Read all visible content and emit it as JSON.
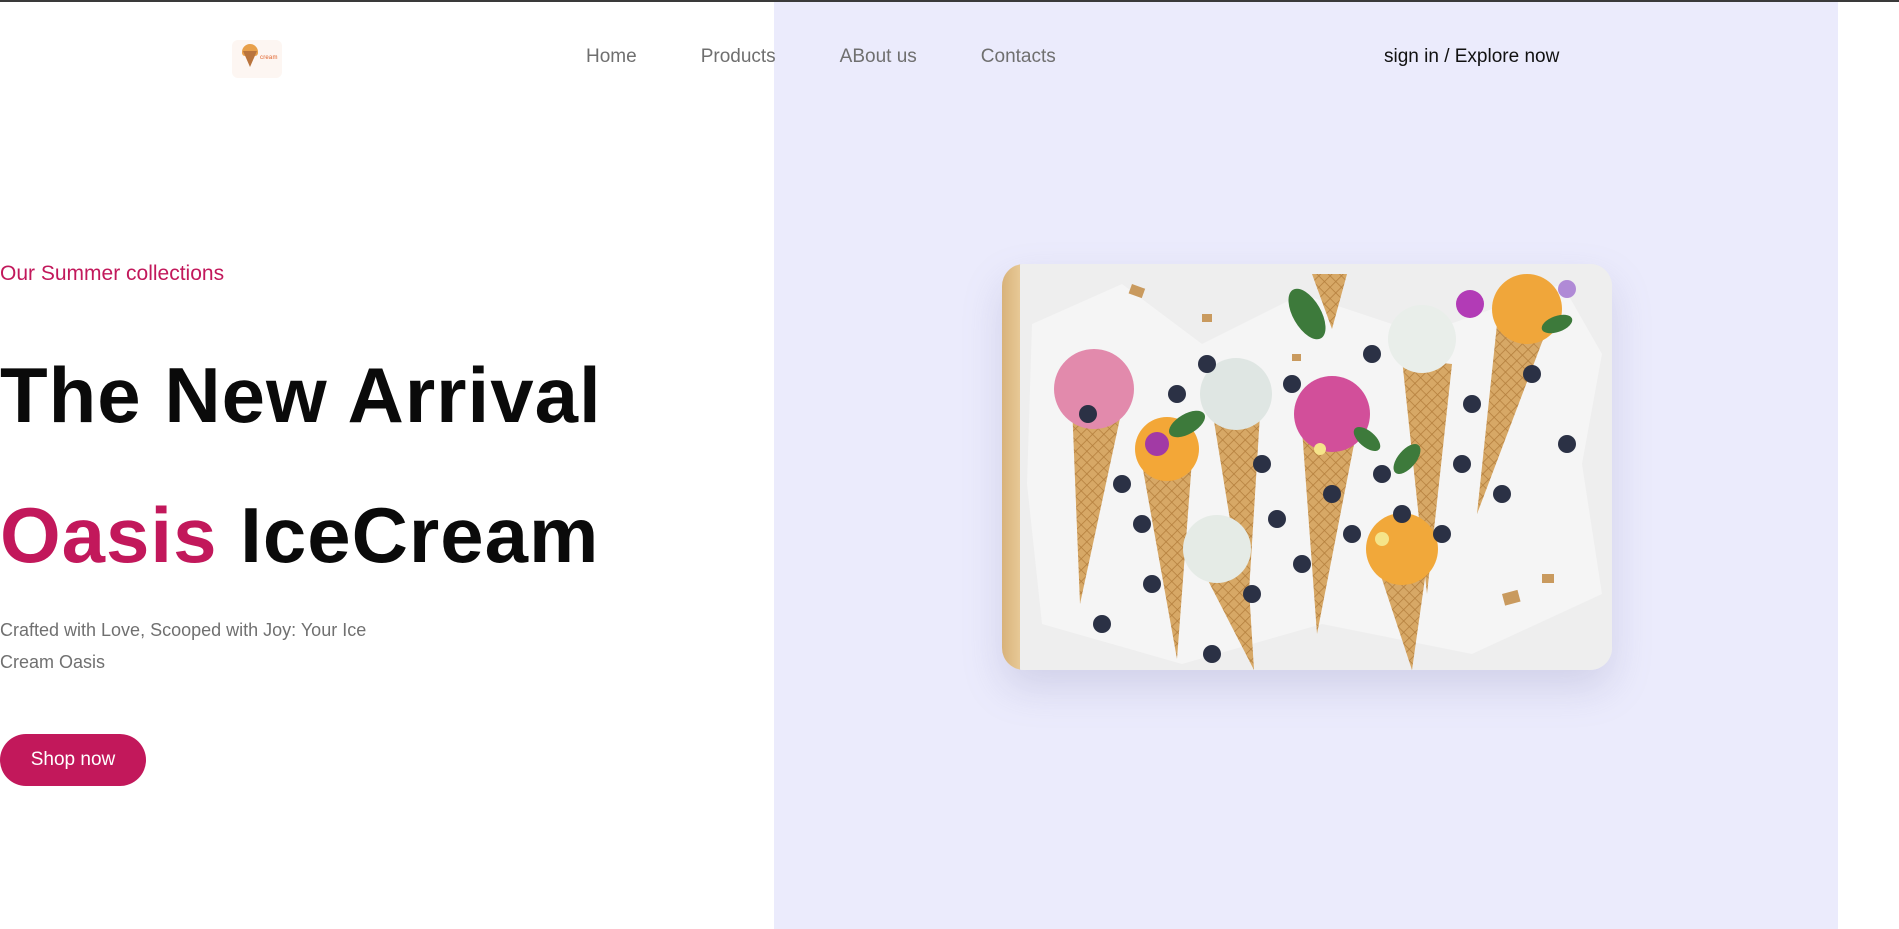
{
  "header": {
    "logo_text": "cream",
    "nav": [
      {
        "label": "Home"
      },
      {
        "label": "Products"
      },
      {
        "label": "ABout us"
      },
      {
        "label": "Contacts"
      }
    ],
    "auth_label": "sign in / Explore now"
  },
  "hero": {
    "eyebrow": "Our Summer collections",
    "title_line1": "The New Arrival",
    "title_accent": "Oasis",
    "title_rest": " IceCream",
    "subtitle": "Crafted with Love, Scooped with Joy: Your Ice Cream Oasis",
    "cta_label": "Shop now",
    "image_icon": "ice-cream-cones-photo"
  },
  "colors": {
    "accent": "#c2185b",
    "panel": "#ebebfc",
    "text_dark": "#0a0a0a",
    "text_muted": "#707070"
  }
}
